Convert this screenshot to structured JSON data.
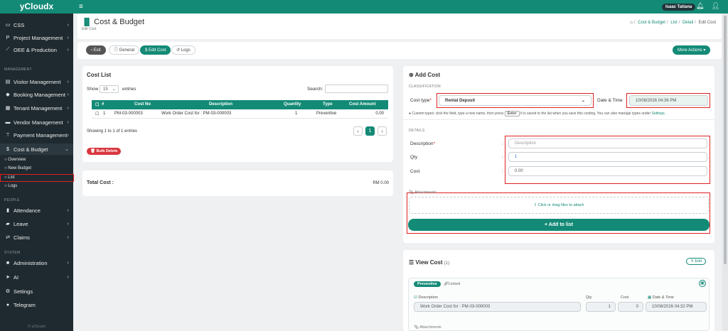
{
  "app": {
    "brand": "yCloudx",
    "footer": "© yCloudx"
  },
  "sidebar": {
    "items": [
      {
        "label": "CSS",
        "icon": "monitor-icon"
      },
      {
        "label": "Project Management",
        "icon": "project-icon"
      },
      {
        "label": "OEE & Production",
        "icon": "chart-line-icon"
      }
    ],
    "section_management": "MANAGEMENT",
    "items2": [
      {
        "label": "Visitor Management",
        "icon": "id-card-icon"
      },
      {
        "label": "Booking Management",
        "icon": "booking-icon"
      },
      {
        "label": "Tenant Management",
        "icon": "building-icon"
      },
      {
        "label": "Vendor Management",
        "icon": "truck-icon"
      },
      {
        "label": "Payment Management",
        "icon": "payment-icon"
      },
      {
        "label": "Cost & Budget",
        "icon": "dollar-icon"
      }
    ],
    "sub": [
      "Overview",
      "New Budget",
      "List",
      "Logs"
    ],
    "section_people": "PEOPLE",
    "items3": [
      {
        "label": "Attendance",
        "icon": "clipboard-icon"
      },
      {
        "label": "Leave",
        "icon": "leave-icon"
      },
      {
        "label": "Claims",
        "icon": "claims-icon"
      }
    ],
    "section_system": "SYSTEM",
    "items4": [
      {
        "label": "Administration",
        "icon": "admin-icon"
      },
      {
        "label": "AI",
        "icon": "ai-icon"
      },
      {
        "label": "Settings",
        "icon": "gear-icon"
      },
      {
        "label": "Telegram",
        "icon": "telegram-icon"
      }
    ]
  },
  "topbar": {
    "user": "Isaac Tatiana"
  },
  "page": {
    "title": "Cost & Budget",
    "subtitle": "Edit Cost",
    "breadcrumb": [
      "Cost & Budget",
      "List",
      "Detail",
      "Edit Cost"
    ]
  },
  "toolbar": {
    "exit": "Exit",
    "general": "General",
    "edit_cost": "Edit Cost",
    "logs": "Logs",
    "more": "More Actions"
  },
  "cost_list": {
    "title": "Cost List",
    "show": "Show",
    "entries_value": "15",
    "entries": "entries",
    "search": "Search:",
    "columns": [
      "#",
      "Cost No",
      "Description",
      "Quantity",
      "Type",
      "Cost Amount"
    ],
    "rows": [
      {
        "num": "1",
        "cost_no": "PM-03-000003",
        "description": "Work Order Cost for : PM-03-000003",
        "quantity": "1",
        "type": "Preventive",
        "amount": "0.00"
      }
    ],
    "info": "Showing 1 to 1 of 1 entries",
    "page": "1",
    "bulk": "Bulk Delete"
  },
  "total": {
    "label": "Total Cost :",
    "value": "RM 0.00"
  },
  "add_cost": {
    "title": "Add Cost",
    "classification": "CLASSIFICATION",
    "cost_type_label": "Cost type",
    "cost_type_value": "Rental Deposit",
    "datetime_label": "Date & Time",
    "datetime_value": "10/08/2026 04:36 PM",
    "hint_a": "Custom types: click the field, type a new name, then press",
    "hint_key": "Enter",
    "hint_b": "It is saved to the list when you save this costing. You can also manage types under",
    "hint_link": "Settings.",
    "details": "DETAILS",
    "description_label": "Description",
    "description_placeholder": "Description",
    "qty_label": "Qty",
    "qty_value": "1",
    "cost_label": "Cost",
    "cost_value": "0.00",
    "attachments": "Attachments",
    "drop": "Click or drag files to attach",
    "add_btn": "Add to list"
  },
  "view_cost": {
    "title": "View Cost",
    "count": "(1)",
    "edit": "Edit",
    "tag": "Preventive",
    "tag2": "Linked",
    "desc_label": "Description",
    "qty_label": "Qty",
    "cost_label": "Cost",
    "date_label": "Date & Time",
    "desc_value": "Work Order Cost for : PM-03-000003",
    "qty_value": "1",
    "cost_value": "0",
    "date_value": "10/08/2026 04:32 PM",
    "attachments": "Attachments"
  }
}
